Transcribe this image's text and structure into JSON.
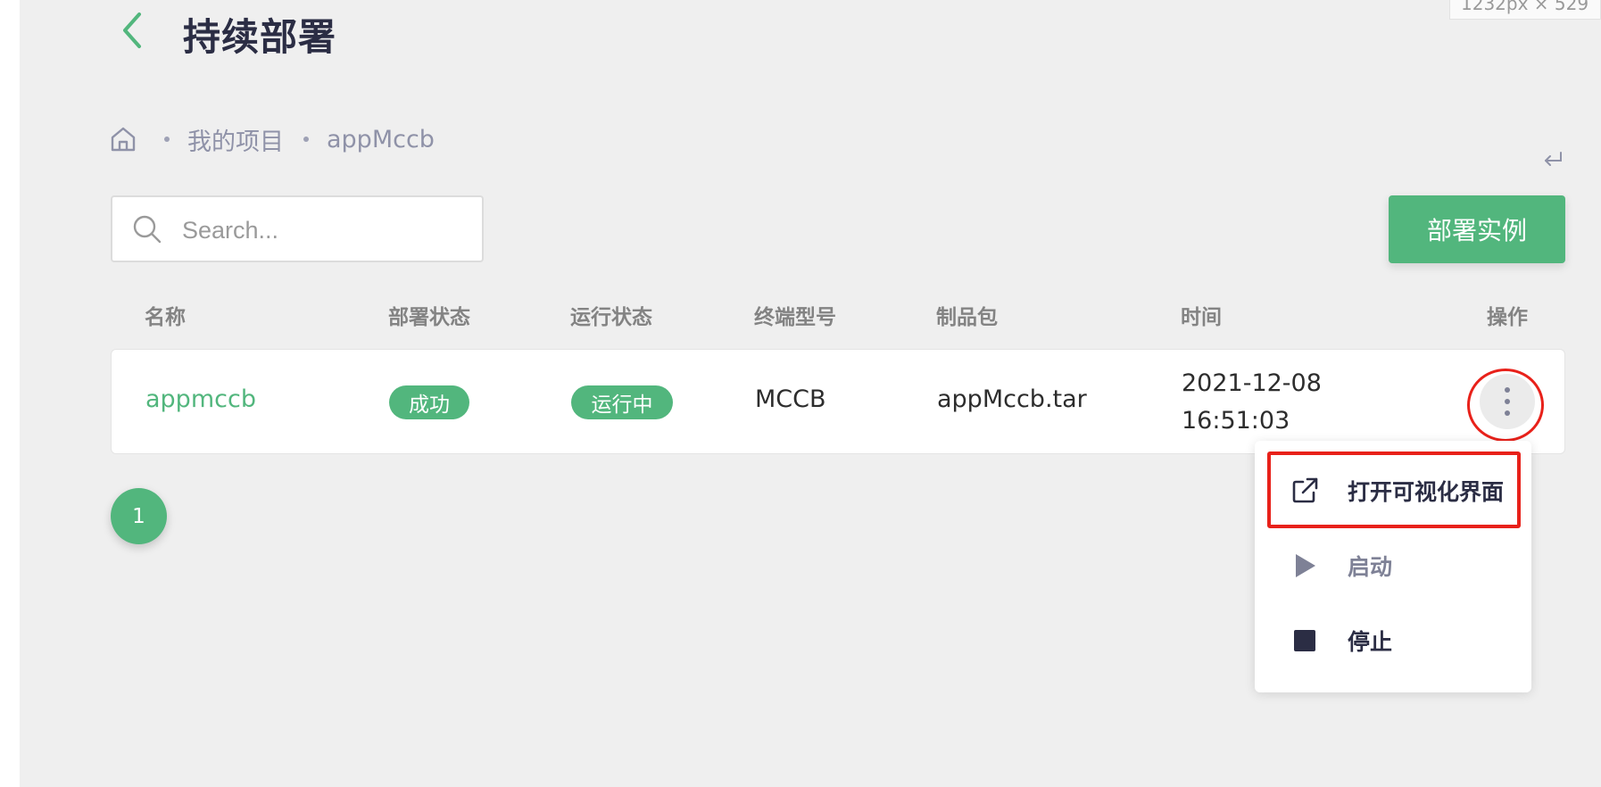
{
  "header": {
    "title": "持续部署",
    "back_icon": "chevron-left-icon",
    "size_tooltip": "1232px × 529"
  },
  "breadcrumb": {
    "home_icon": "home-icon",
    "items": [
      "我的项目",
      "appMccb"
    ],
    "enter_icon": "enter-return-icon"
  },
  "search": {
    "placeholder": "Search...",
    "value": "",
    "icon": "search-icon"
  },
  "toolbar": {
    "deploy_label": "部署实例"
  },
  "table": {
    "columns": [
      "名称",
      "部署状态",
      "运行状态",
      "终端型号",
      "制品包",
      "时间",
      "操作"
    ],
    "rows": [
      {
        "name": "appmccb",
        "deploy_status": "成功",
        "run_status": "运行中",
        "terminal_model": "MCCB",
        "artifact": "appMccb.tar",
        "date": "2021-12-08",
        "time": "16:51:03",
        "action_icon": "more-vertical-icon"
      }
    ]
  },
  "pagination": {
    "current_page": "1"
  },
  "dropdown_menu": {
    "items": [
      {
        "label": "打开可视化界面",
        "icon": "external-link-icon"
      },
      {
        "label": "启动",
        "icon": "play-icon"
      },
      {
        "label": "停止",
        "icon": "stop-icon"
      }
    ]
  },
  "colors": {
    "accent": "#52b67d",
    "highlight": "#e8211a",
    "background": "#efefef",
    "text_dark": "#2b2d44"
  }
}
